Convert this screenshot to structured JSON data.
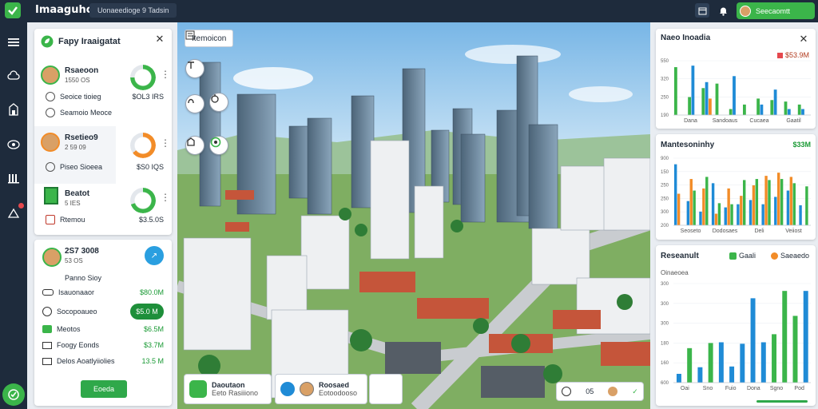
{
  "app": {
    "title": "Imaaguhct",
    "breadcrumb": "Uonaeedioge 9  Tadsin",
    "user_name": "Seecaomtt"
  },
  "left_panel": {
    "header": "Fapy Iraaigatat",
    "properties": [
      {
        "title": "Rsaeoon",
        "subtitle": "1550 OS",
        "ring_fraction": 0.75,
        "ring_color": "#3bb54a",
        "rows": [
          {
            "label": "Seoice tioieg",
            "value": "$OL3 IRS",
            "value_color": "#1f2a37"
          },
          {
            "label": "Seamoio Meoce",
            "value": "",
            "value_color": "#1f2a37"
          }
        ]
      },
      {
        "title": "Rsetieo9",
        "subtitle": "2 59 09",
        "ring_fraction": 0.65,
        "ring_color": "#f28c28",
        "rows": [
          {
            "label": "Piseo Sioeea",
            "value": "$S0 IQS",
            "value_color": "#1f2a37"
          }
        ]
      },
      {
        "title": "Beatot",
        "subtitle": "5 IES",
        "ring_fraction": 0.7,
        "ring_color": "#3bb54a",
        "rows": [
          {
            "label": "Rtemou",
            "value": "$3.5.0S",
            "value_color": "#1f2a37"
          }
        ]
      }
    ]
  },
  "lower_panel": {
    "title": "2S7 3008",
    "subtitle": "53 OS",
    "id_line": "Panno Sioy",
    "rows": [
      {
        "label": "Isauonaaor",
        "value": "$80.0M"
      },
      {
        "label": "Socopoaueo",
        "value": ""
      },
      {
        "label": "Meotos",
        "value": "$6.5M"
      },
      {
        "label": "Foogy Eonds",
        "value": "$3.7M"
      },
      {
        "label": "Delos Aoatlyiiolies",
        "value": "13.5 M"
      }
    ],
    "pill_label": "$5.0 M",
    "button_label": "Eoeda"
  },
  "map": {
    "label": "Itemoicon",
    "bottom_cards": [
      {
        "title": "Daoutaon",
        "subtitle": "Eeto Rasiiiono"
      },
      {
        "title": "Roosaed",
        "subtitle": "Eotoodooso"
      },
      {
        "title": "",
        "subtitle": ""
      }
    ],
    "right_card": {
      "value": "05"
    }
  },
  "charts": {
    "top": {
      "title": "Naeo Inoadia",
      "tag": "$53.9M",
      "chart_data": {
        "type": "bar",
        "yticks": [
          "550",
          "320",
          "250",
          "190"
        ],
        "categories": [
          "Dana",
          "Sandoaus",
          "Cucaea",
          "Gaatil"
        ],
        "series": [
          {
            "name": "",
            "color": "#3bb54a",
            "values": [
              32,
              12,
              18,
              21,
              4,
              7,
              11,
              10,
              9,
              7
            ]
          },
          {
            "name": "",
            "color": "#1f8bd6",
            "values": [
              0,
              33,
              22,
              0,
              26,
              0,
              7,
              17,
              4,
              4
            ]
          },
          {
            "name": "",
            "color": "#f28c28",
            "values": [
              0,
              0,
              11,
              0,
              0,
              0,
              0,
              0,
              0,
              0
            ]
          }
        ]
      }
    },
    "middle": {
      "title": "Mantesoninhy",
      "value": "$33M",
      "chart_data": {
        "type": "bar",
        "yticks": [
          "900",
          "150",
          "250",
          "250",
          "300",
          "200"
        ],
        "categories": [
          "Seoseto",
          "Dodosaes",
          "Deli",
          "Veiiost"
        ],
        "series": [
          {
            "name": "",
            "color": "#1f8bd6",
            "values": [
              58,
              23,
              13,
              40,
              17,
              20,
              24,
              20,
              27,
              33,
              19
            ]
          },
          {
            "name": "",
            "color": "#f28c28",
            "values": [
              30,
              44,
              35,
              11,
              35,
              28,
              38,
              47,
              50,
              46,
              0
            ]
          },
          {
            "name": "",
            "color": "#3bb54a",
            "values": [
              0,
              33,
              46,
              21,
              20,
              43,
              44,
              43,
              44,
              40,
              37
            ]
          }
        ]
      }
    },
    "bottom": {
      "title": "Reseanult",
      "legend": [
        {
          "label": "Gaali",
          "color": "#3bb54a"
        },
        {
          "label": "Saeaedo",
          "color": "#f28c28"
        }
      ],
      "subtitle": "Oinaeoea",
      "chart_data": {
        "type": "bar",
        "yticks": [
          "300",
          "300",
          "300",
          "180",
          "160",
          "600"
        ],
        "categories": [
          "Oai",
          "Sno",
          "Fuio",
          "Dona",
          "Sgno",
          "Pod"
        ],
        "values": [
          12,
          47,
          21,
          54,
          55,
          22,
          53,
          115,
          55,
          66,
          125,
          91,
          125
        ],
        "colors": [
          "#1f8bd6",
          "#3bb54a",
          "#1f8bd6",
          "#3bb54a",
          "#1f8bd6",
          "#1f8bd6",
          "#1f8bd6",
          "#1f8bd6",
          "#1f8bd6",
          "#3bb54a",
          "#3bb54a",
          "#3bb54a",
          "#1f8bd6"
        ]
      }
    }
  }
}
